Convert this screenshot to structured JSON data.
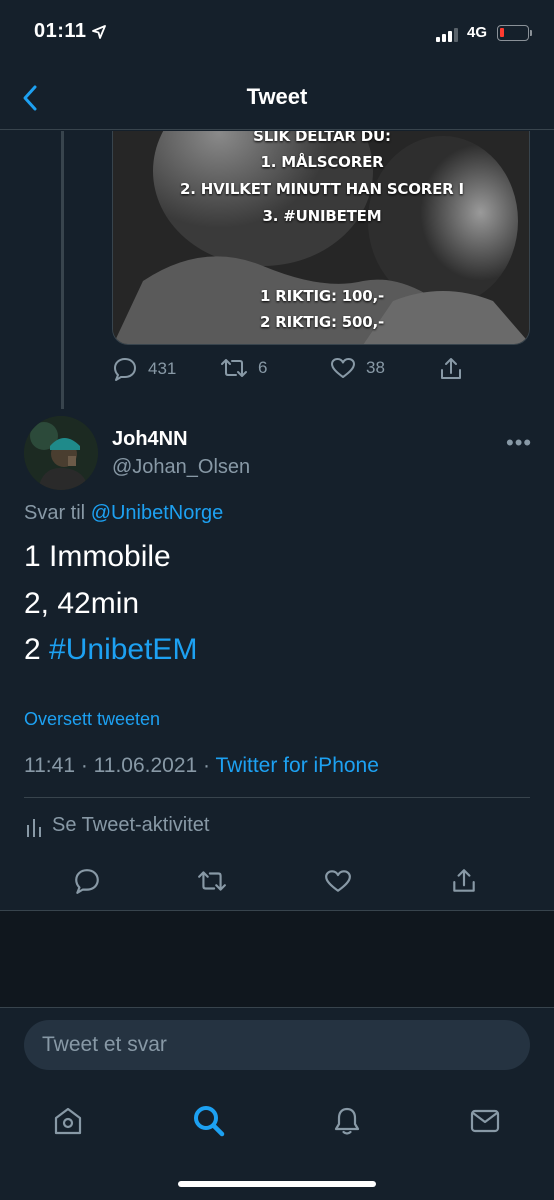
{
  "status_bar": {
    "time": "01:11",
    "network": "4G"
  },
  "header": {
    "title": "Tweet"
  },
  "parent_tweet": {
    "image_text": [
      "SLIK DELTAR DU:",
      "1. MÅLSCORER",
      "2.  HVILKET MINUTT HAN SCORER I",
      "3. #UNIBETEM",
      "1 RIKTIG: 100,-",
      "2 RIKTIG: 500,-"
    ],
    "replies": "431",
    "retweets": "6",
    "likes": "38"
  },
  "tweet": {
    "name": "Joh4NN",
    "handle": "@Johan_Olsen",
    "reply_prefix": "Svar til",
    "reply_to": "@UnibetNorge",
    "lines": [
      "1 Immobile",
      "2, 42min",
      "2"
    ],
    "hashtag": "#UnibetEM",
    "translate": "Oversett tweeten",
    "timestamp": "11:41 · 11.06.2021 ·",
    "source": "Twitter for iPhone",
    "activity": "Se Tweet-aktivitet"
  },
  "compose": {
    "placeholder": "Tweet et svar"
  },
  "colors": {
    "background": "#15202b",
    "accent": "#1da1f2",
    "muted": "#8899a6",
    "border": "#38444d"
  },
  "icons": {
    "back": "chevron-left-icon",
    "reply": "speech-bubble-icon",
    "retweet": "retweet-icon",
    "like": "heart-icon",
    "share": "share-icon",
    "home": "home-icon",
    "search": "search-icon",
    "notifications": "bell-icon",
    "messages": "mail-icon"
  }
}
